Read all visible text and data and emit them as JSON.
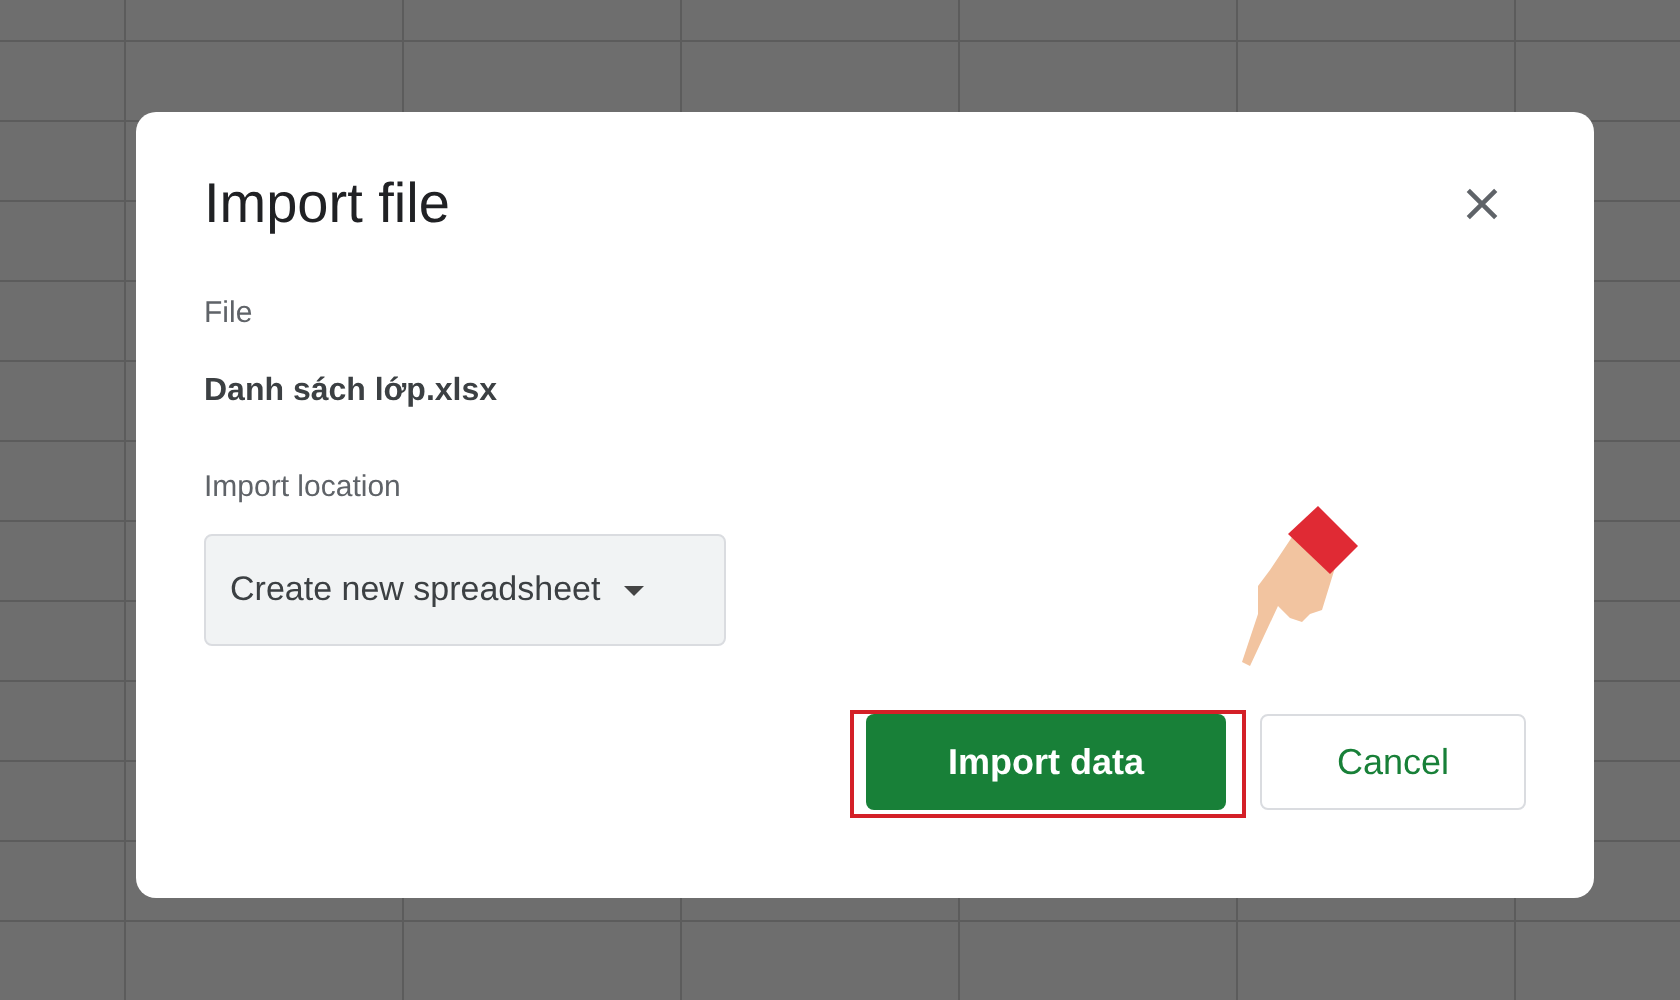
{
  "dialog": {
    "title": "Import file",
    "file_label": "File",
    "file_name": "Danh sách lớp.xlsx",
    "location_label": "Import location",
    "location_dropdown": {
      "value": "Create new spreadsheet"
    },
    "buttons": [
      {
        "label": "Import data",
        "kind": "primary",
        "highlighted": true
      },
      {
        "label": "Cancel",
        "kind": "secondary",
        "highlighted": false
      }
    ]
  }
}
